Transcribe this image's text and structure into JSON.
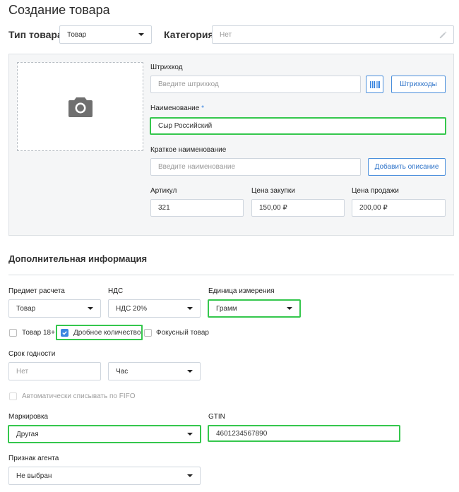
{
  "page": {
    "title": "Создание товара"
  },
  "header": {
    "product_type_label": "Тип товара",
    "product_type_value": "Товар",
    "category_label": "Категория",
    "category_placeholder": "Нет"
  },
  "main": {
    "barcode_label": "Штрихкод",
    "barcode_placeholder": "Введите штрихкод",
    "barcodes_button": "Штрихкоды",
    "name_label": "Наименование",
    "name_required_mark": "*",
    "name_value": "Сыр Российский",
    "short_name_label": "Краткое наименование",
    "short_name_placeholder": "Введите наименование",
    "add_description_button": "Добавить описание",
    "article_label": "Артикул",
    "article_value": "321",
    "purchase_price_label": "Цена закупки",
    "purchase_price_value": "150,00 ₽",
    "sale_price_label": "Цена продажи",
    "sale_price_value": "200,00 ₽"
  },
  "additional": {
    "section_title": "Дополнительная информация",
    "payment_subject_label": "Предмет расчета",
    "payment_subject_value": "Товар",
    "vat_label": "НДС",
    "vat_value": "НДС 20%",
    "unit_label": "Единица измерения",
    "unit_value": "Грамм",
    "checkbox_18_label": "Товар 18+",
    "checkbox_18_checked": false,
    "checkbox_fractional_label": "Дробное количество",
    "checkbox_fractional_checked": true,
    "checkbox_focus_label": "Фокусный товар",
    "checkbox_focus_checked": false,
    "shelf_life_label": "Срок годности",
    "shelf_life_placeholder": "Нет",
    "shelf_life_unit": "Час",
    "fifo_label": "Автоматически списывать по FIFO",
    "marking_label": "Маркировка",
    "marking_value": "Другая",
    "gtin_label": "GTIN",
    "gtin_value": "4601234567890",
    "agent_label": "Признак агента",
    "agent_value": "Не выбран"
  },
  "colors": {
    "accent": "#3b86e0",
    "highlight": "#35c74d",
    "panel_bg": "#f5f6f7"
  },
  "icons": {
    "camera": "camera-icon",
    "barcode": "barcode-icon",
    "pencil": "pencil-icon",
    "checkmark": "checkmark-icon"
  }
}
